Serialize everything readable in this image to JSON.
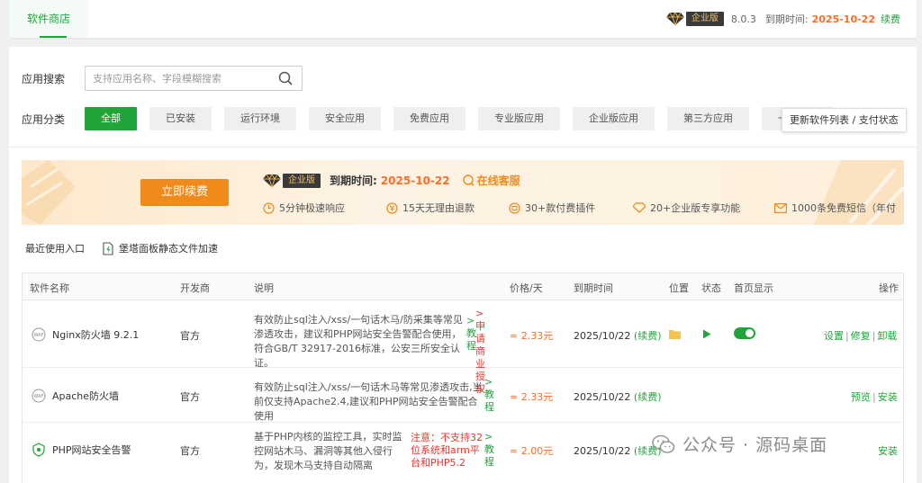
{
  "topbar": {
    "tab": "软件商店",
    "badge": "企业版",
    "version": "8.0.3",
    "expire_label": "到期时间:",
    "expire_date": "2025-10-22",
    "renew": "续费"
  },
  "search": {
    "label": "应用搜索",
    "placeholder": "支持应用名称、字段模糊搜索"
  },
  "category": {
    "label": "应用分类",
    "items": [
      "全部",
      "已安装",
      "运行环境",
      "安全应用",
      "免费应用",
      "专业版应用",
      "企业版应用",
      "第三方应用",
      "一键部署"
    ],
    "update_button": "更新软件列表 / 支付状态"
  },
  "banner": {
    "renew_button": "立即续费",
    "badge": "企业版",
    "expire_label": "到期时间:",
    "expire_date": "2025-10-22",
    "service": "在线客服",
    "features": [
      "5分钟极速响应",
      "15天无理由退款",
      "30+款付费插件",
      "20+企业版专享功能",
      "1000条免费短信（年付"
    ]
  },
  "quick": {
    "recent": "最近使用入口",
    "cdn": "堡塔面板静态文件加速"
  },
  "table": {
    "headers": [
      "软件名称",
      "开发商",
      "说明",
      "价格/天",
      "到期时间",
      "位置",
      "状态",
      "首页显示",
      "操作"
    ],
    "rows": [
      {
        "name": "Nginx防火墙 9.2.1",
        "dev": "官方",
        "desc": "有效防止sql注入/xss/一句话木马/防采集等常见渗透攻击，建议和PHP网站安全告警配合使用，符合GB/T 32917-2016标准，公安三所安全认证。",
        "tutorial": ">教程",
        "extra": ">申请商业授权",
        "price": "≈ 2.33元",
        "expire": "2025/10/22",
        "renew": "(续费)",
        "ops": [
          "设置",
          "修复",
          "卸载"
        ]
      },
      {
        "name": "Apache防火墙",
        "dev": "官方",
        "desc": "有效防止sql注入/xss/一句话木马等常见渗透攻击,当前仅支持Apache2.4,建议和PHP网站安全告警配合使用",
        "tutorial": ">教程",
        "price": "≈ 2.33元",
        "expire": "2025/10/22",
        "renew": "(续费)",
        "ops": [
          "预览",
          "安装"
        ]
      },
      {
        "name": "PHP网站安全告警",
        "dev": "官方",
        "desc": "基于PHP内核的监控工具，实时监控网站木马、漏洞等其他入侵行为，发现木马支持自动隔离",
        "warning": "注意：不支持32位系统和arm平台和PHP5.2",
        "tutorial": ">教程",
        "price": "≈ 2.00元",
        "expire": "2025/10/22",
        "renew": "(续费)",
        "ops": [
          "安装"
        ]
      }
    ]
  },
  "watermark": "公众号 · 源码桌面",
  "colors": {
    "accent": "#20a53a",
    "orange": "#fc6d26",
    "button_orange": "#f08a1a",
    "red": "#e8362d"
  }
}
